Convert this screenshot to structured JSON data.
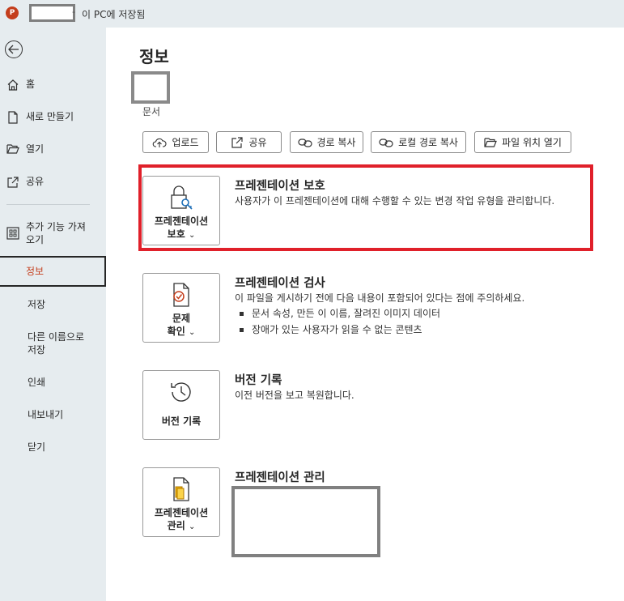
{
  "titlebar": {
    "app_icon": "P",
    "separator": "-",
    "status": "이 PC에 저장됨"
  },
  "sidebar": {
    "back_icon": "back-arrow-icon",
    "items": [
      {
        "label": "홈",
        "icon": "home-icon"
      },
      {
        "label": "새로 만들기",
        "icon": "new-document-icon"
      },
      {
        "label": "열기",
        "icon": "folder-open-icon"
      },
      {
        "label": "공유",
        "icon": "share-icon"
      },
      {
        "label": "추가 기능 가져오기",
        "icon": "addins-grid-icon"
      },
      {
        "label": "정보",
        "active": true
      },
      {
        "label": "저장"
      },
      {
        "label": "다른 이름으로 저장"
      },
      {
        "label": "인쇄"
      },
      {
        "label": "내보내기"
      },
      {
        "label": "닫기"
      }
    ]
  },
  "main": {
    "title": "정보",
    "doc_label": "문서",
    "toolbar": [
      {
        "label": "업로드",
        "icon": "cloud-upload-icon"
      },
      {
        "label": "공유",
        "icon": "share-icon"
      },
      {
        "label": "경로 복사",
        "icon": "link-icon"
      },
      {
        "label": "로컬 경로 복사",
        "icon": "link-icon"
      },
      {
        "label": "파일 위치 열기",
        "icon": "folder-open-icon"
      }
    ],
    "sections": [
      {
        "button_label_1": "프레젠테이션",
        "button_label_2": "보호",
        "icon": "lock-key-icon",
        "title": "프레젠테이션 보호",
        "description": "사용자가 이 프레젠테이션에 대해 수행할 수 있는 변경 작업 유형을 관리합니다."
      },
      {
        "button_label_1": "문제",
        "button_label_2": "확인",
        "icon": "inspect-document-icon",
        "title": "프레젠테이션 검사",
        "description": "이 파일을 게시하기 전에 다음 내용이 포함되어 있다는 점에 주의하세요.",
        "bullets": [
          "문서 속성, 만든 이 이름, 잘려진 이미지 데이터",
          "장애가 있는 사용자가 읽을 수 없는 콘텐츠"
        ]
      },
      {
        "button_label_1": "버전 기록",
        "icon": "history-clock-icon",
        "title": "버전 기록",
        "description": "이전 버전을 보고 복원합니다."
      },
      {
        "button_label_1": "프레젠테이션",
        "button_label_2": "관리",
        "icon": "manage-presentation-icon",
        "title": "프레젠테이션 관리"
      }
    ],
    "chevron": "⌄"
  },
  "colors": {
    "accent": "#c43e1c",
    "highlight": "#e0202a",
    "sidebar_bg": "#e6ecef"
  }
}
